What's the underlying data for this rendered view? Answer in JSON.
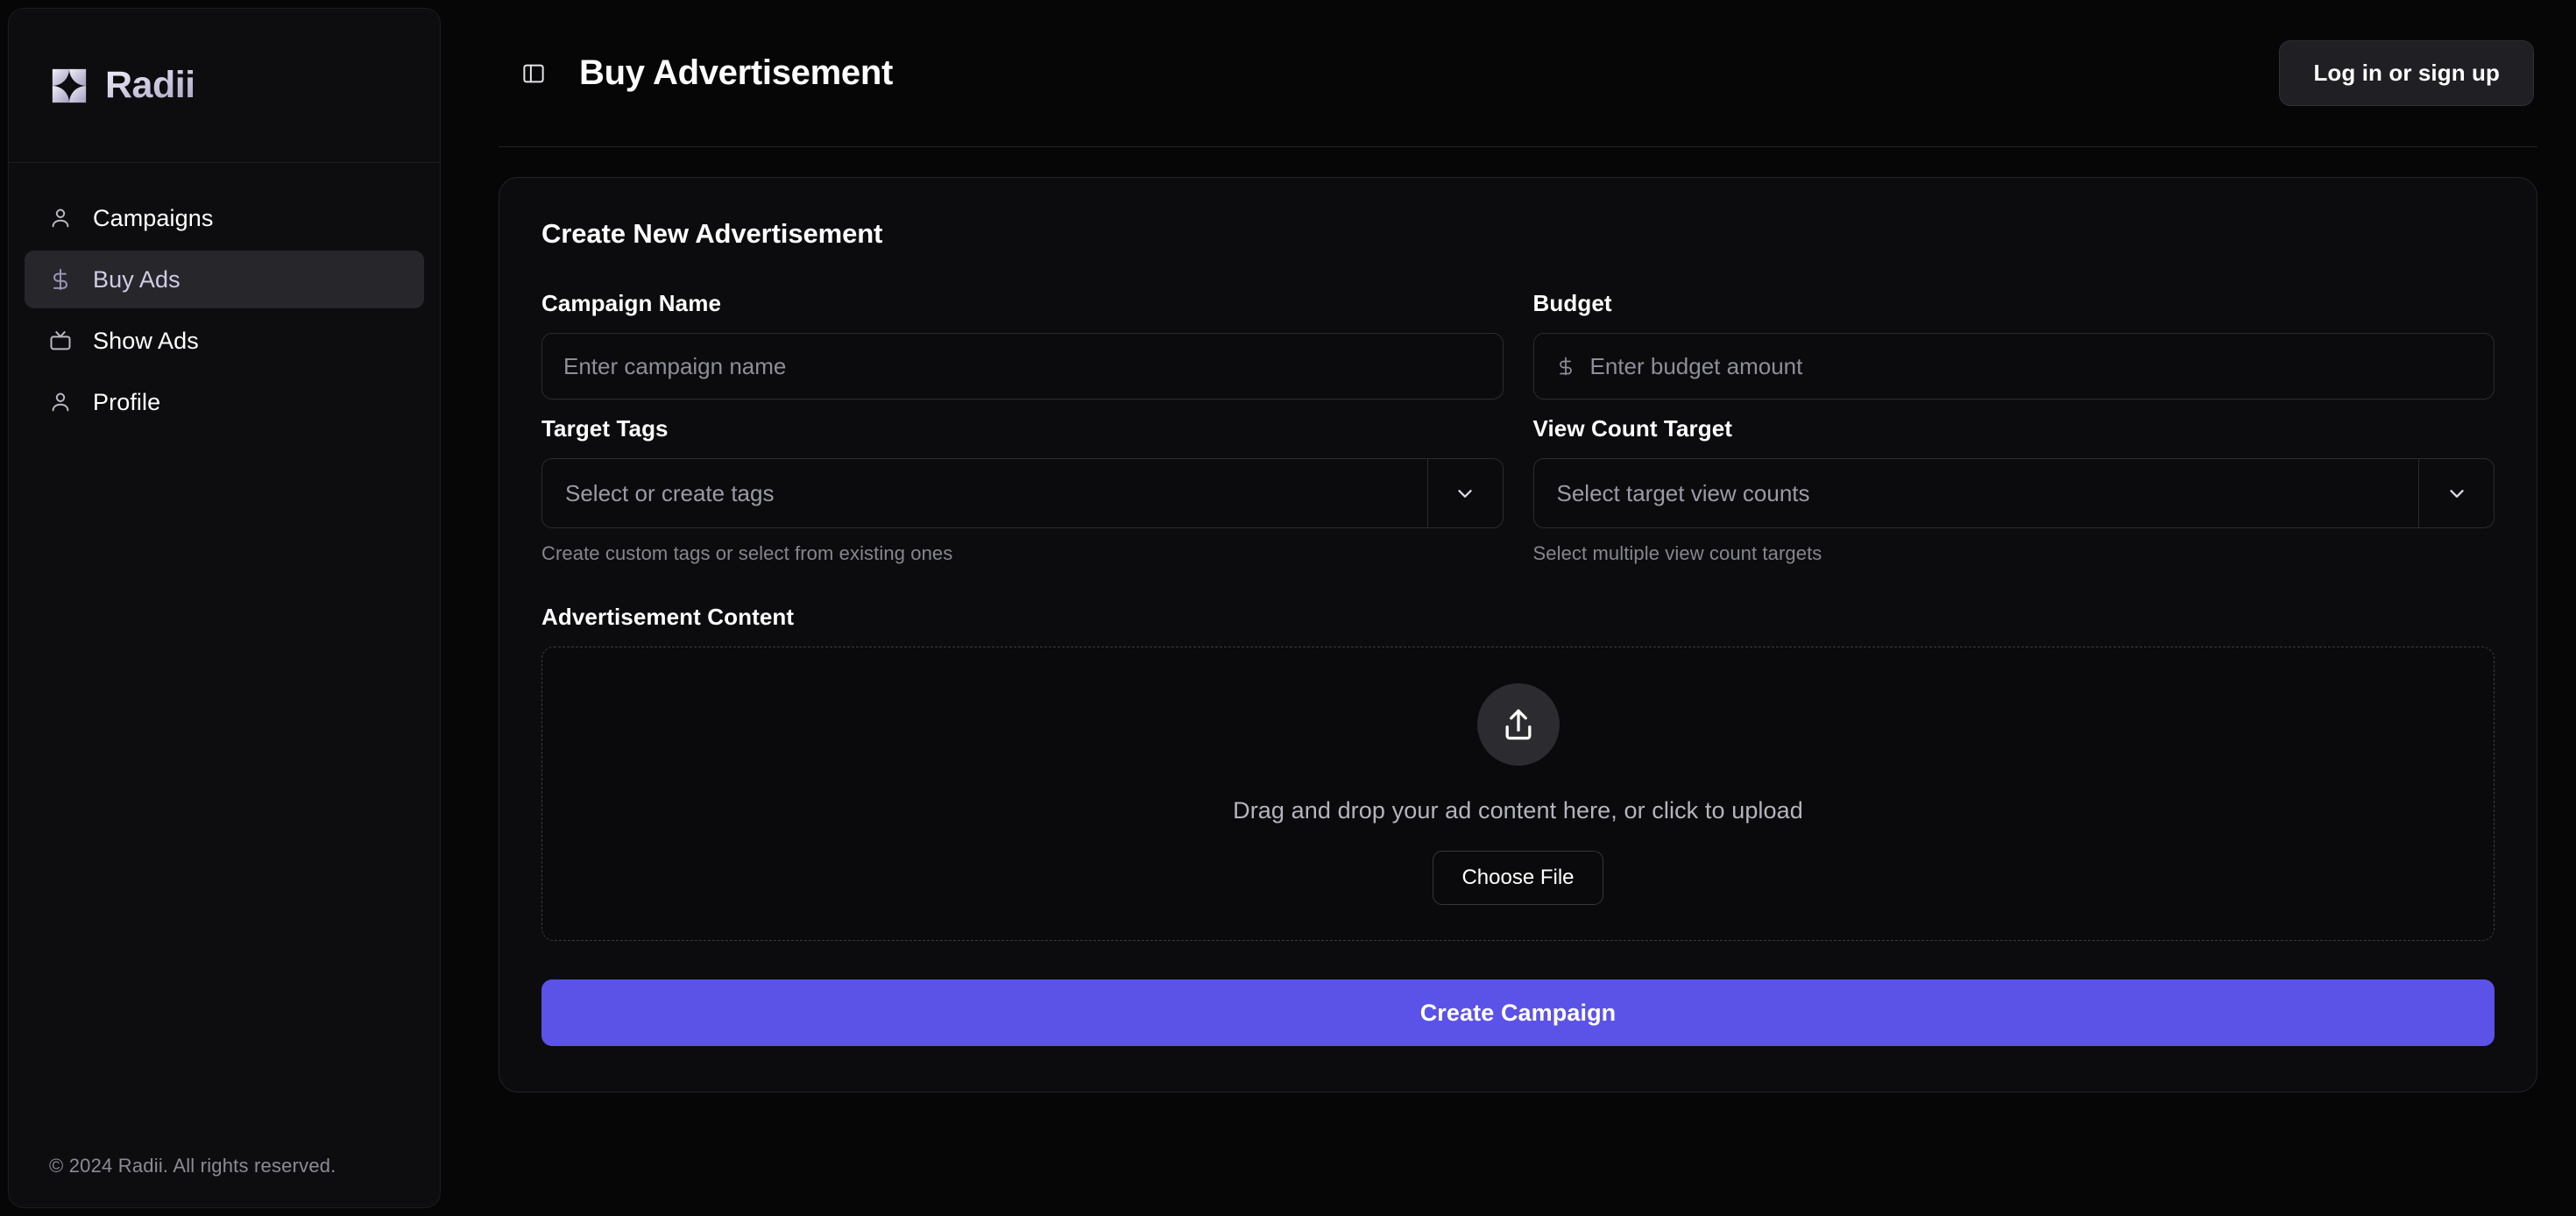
{
  "sidebar": {
    "brand": {
      "name": "Radii",
      "logo_icon": "radii-petal-logo"
    },
    "items": [
      {
        "label": "Campaigns",
        "icon": "user-icon",
        "active": false
      },
      {
        "label": "Buy Ads",
        "icon": "dollar-icon",
        "active": true
      },
      {
        "label": "Show Ads",
        "icon": "tv-icon",
        "active": false
      },
      {
        "label": "Profile",
        "icon": "user-icon",
        "active": false
      }
    ],
    "footer": "© 2024 Radii. All rights reserved."
  },
  "topbar": {
    "toggle_icon": "panel-left-icon",
    "title": "Buy Advertisement",
    "login_label": "Log in or sign up"
  },
  "form": {
    "card_title": "Create New Advertisement",
    "campaign_name": {
      "label": "Campaign Name",
      "placeholder": "Enter campaign name",
      "value": ""
    },
    "budget": {
      "label": "Budget",
      "prefix": "$",
      "prefix_icon": "dollar-icon",
      "placeholder": "Enter budget amount",
      "value": ""
    },
    "target_tags": {
      "label": "Target Tags",
      "placeholder": "Select or create tags",
      "help": "Create custom tags or select from existing ones",
      "caret_icon": "chevron-down-icon"
    },
    "view_count_target": {
      "label": "View Count Target",
      "placeholder": "Select target view counts",
      "help": "Select multiple view count targets",
      "caret_icon": "chevron-down-icon"
    },
    "ad_content": {
      "label": "Advertisement Content",
      "upload_icon": "upload-icon",
      "dropzone_text": "Drag and drop your ad content here, or click to upload",
      "choose_file_label": "Choose File"
    },
    "submit_label": "Create Campaign"
  },
  "colors": {
    "accent": "#5B52E8",
    "page_background": "#060607",
    "sidebar_background": "#0D0D0F",
    "card_background": "#0C0C0E",
    "border": "#232327",
    "active_nav_background": "#27272B",
    "muted_text": "#8E8E99"
  }
}
